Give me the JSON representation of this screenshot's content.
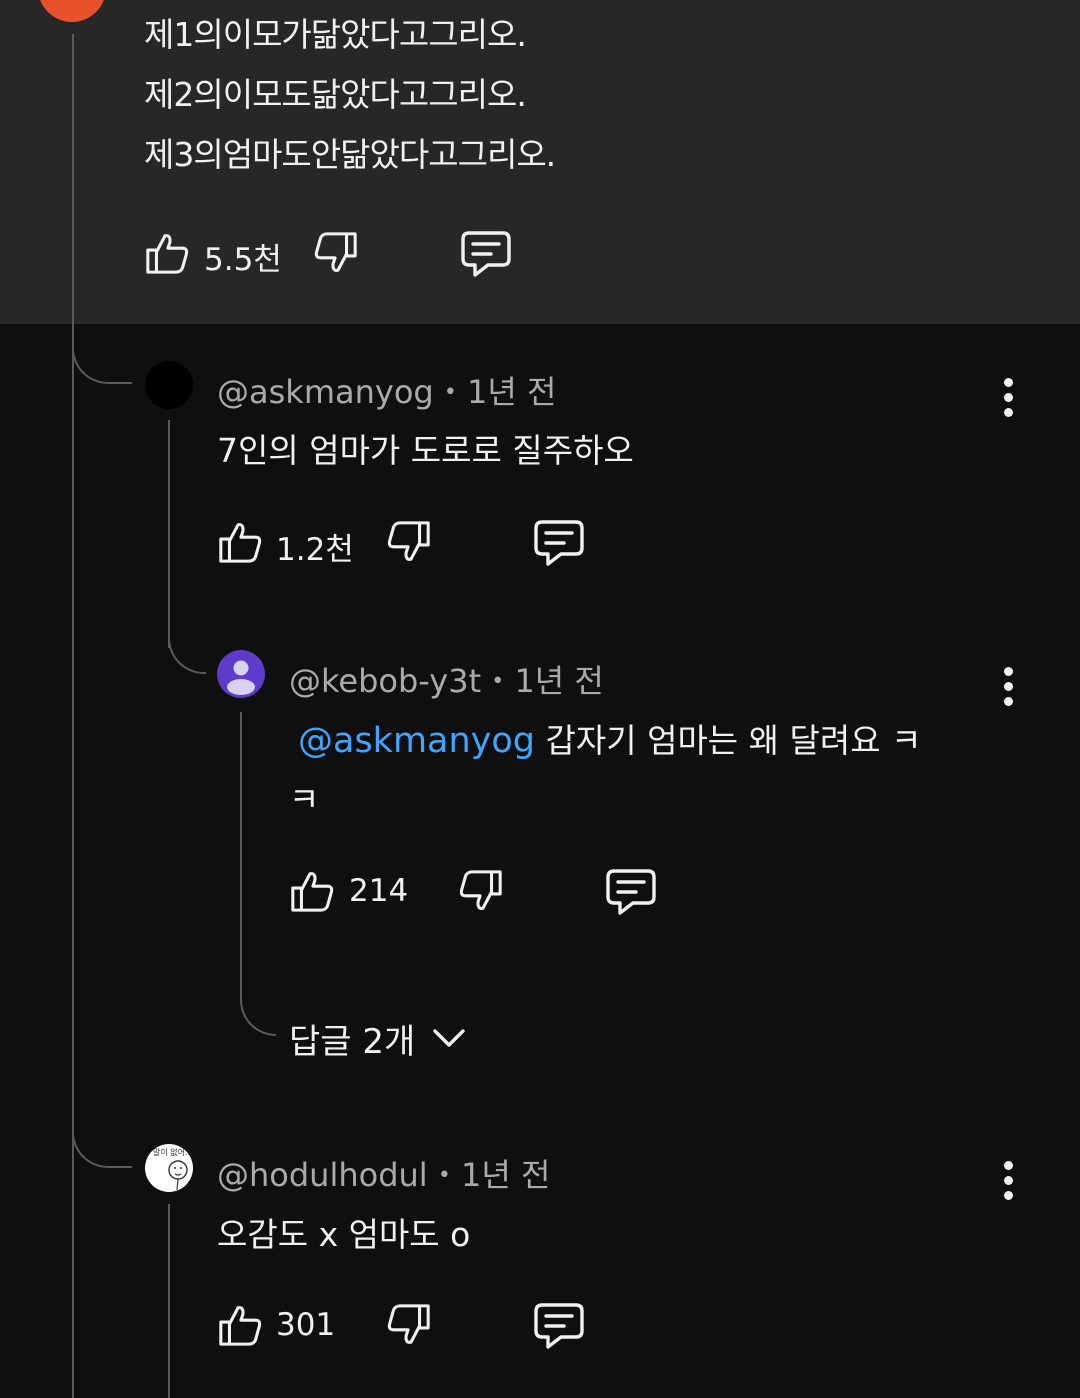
{
  "top_comment": {
    "lines": [
      "제1의이모가닮았다고그리오.",
      "제2의이모도닮았다고그리오.",
      "제3의엄마도안닮았다고그리오."
    ],
    "likes": "5.5천"
  },
  "replies": [
    {
      "author": "@askmanyog",
      "dot": "•",
      "time": "1년 전",
      "text": "7인의 엄마가 도로로 질주하오",
      "likes": "1.2천"
    },
    {
      "author": "@kebob-y3t",
      "dot": "•",
      "time": "1년 전",
      "mention": "@askmanyog",
      "text_line1": " 갑자기 엄마는 왜 달려요 ㅋ",
      "text_line2": "ㅋ",
      "likes": "214",
      "more_replies": "답글 2개"
    },
    {
      "author": "@hodulhodul",
      "dot": "•",
      "time": "1년 전",
      "text": "오감도 x 엄마도 o",
      "likes": "301",
      "avatar_text": "말이 없어.."
    }
  ],
  "icons": [
    "like-icon",
    "dislike-icon",
    "reply-icon",
    "more-icon",
    "chevron-down-icon"
  ],
  "colors": {
    "background": "#0f0f0f",
    "highlight_panel": "#272727",
    "mention": "#3ea6ff",
    "avatar_purple": "#5c3cc8",
    "avatar_orange": "#e8522a"
  }
}
